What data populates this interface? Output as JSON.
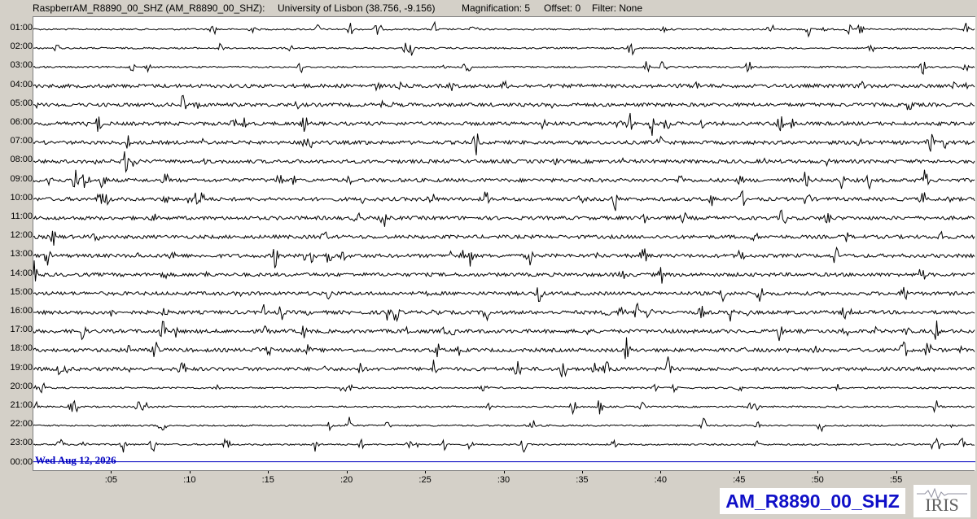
{
  "header": {
    "station": "RaspberrAM_R8890_00_SHZ (AM_R8890_00_SHZ):",
    "location": "University of Lisbon (38.756, -9.156)",
    "magnification": "Magnification: 5",
    "offset": "Offset: 0",
    "filter": "Filter: None"
  },
  "hours": [
    "01:00",
    "02:00",
    "03:00",
    "04:00",
    "05:00",
    "06:00",
    "07:00",
    "08:00",
    "09:00",
    "10:00",
    "11:00",
    "12:00",
    "13:00",
    "14:00",
    "15:00",
    "16:00",
    "17:00",
    "18:00",
    "19:00",
    "20:00",
    "21:00",
    "22:00",
    "23:00",
    "00:00"
  ],
  "date_label": "Wed Aug 12, 2026",
  "minute_ticks": [
    ":05",
    ":10",
    ":15",
    ":20",
    ":25",
    ":30",
    ":35",
    ":40",
    ":45",
    ":50",
    ":55"
  ],
  "station_label": "AM_R8890_00_SHZ",
  "logo_label": "IRIS",
  "colors": {
    "trace": "#000000",
    "current_line": "#0000c0",
    "station_text": "#1010c8"
  }
}
